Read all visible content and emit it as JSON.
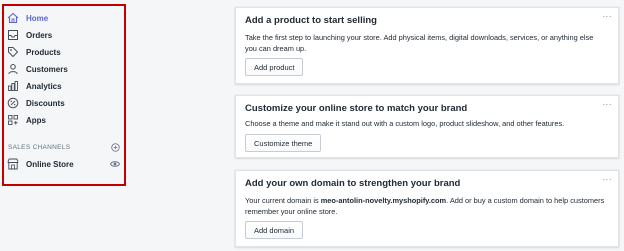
{
  "sidebar": {
    "items": [
      {
        "label": "Home",
        "icon": "home-icon",
        "active": true
      },
      {
        "label": "Orders",
        "icon": "orders-icon",
        "active": false
      },
      {
        "label": "Products",
        "icon": "tag-icon",
        "active": false
      },
      {
        "label": "Customers",
        "icon": "person-icon",
        "active": false
      },
      {
        "label": "Analytics",
        "icon": "bar-chart-icon",
        "active": false
      },
      {
        "label": "Discounts",
        "icon": "discount-icon",
        "active": false
      },
      {
        "label": "Apps",
        "icon": "apps-icon",
        "active": false
      }
    ],
    "sales_channels_title": "SALES CHANNELS",
    "online_store_label": "Online Store",
    "accent_color": "#5c6ac4",
    "highlight_border_color": "#c00000"
  },
  "cards": [
    {
      "title": "Add a product to start selling",
      "description": "Take the first step to launching your store. Add physical items, digital downloads, services, or anything else you can dream up.",
      "button": "Add product"
    },
    {
      "title": "Customize your online store to match your brand",
      "description": "Choose a theme and make it stand out with a custom logo, product slideshow, and other features.",
      "button": "Customize theme"
    },
    {
      "title": "Add your own domain to strengthen your brand",
      "description_prefix": "Your current domain is ",
      "domain": "meo-antolin-novelty.myshopify.com",
      "description_suffix": ". Add or buy a custom domain to help customers remember your online store.",
      "button": "Add domain"
    }
  ],
  "more_glyph": "···"
}
